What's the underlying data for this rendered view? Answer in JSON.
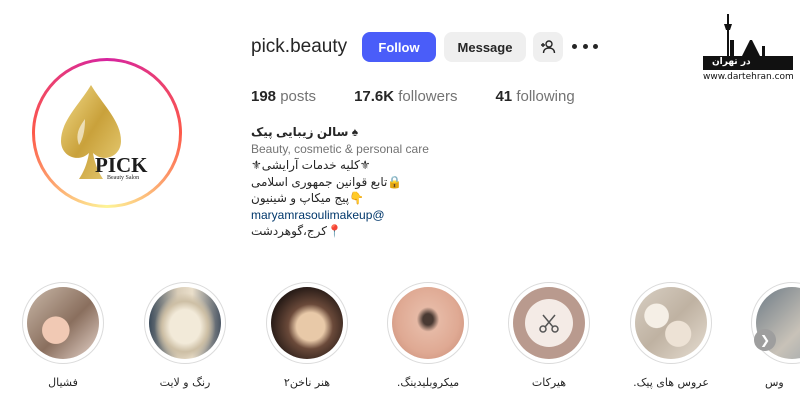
{
  "profile": {
    "username": "pick.beauty",
    "logo_text": "PICK",
    "logo_sub": "Beauty Salon"
  },
  "actions": {
    "follow_label": "Follow",
    "message_label": "Message",
    "add_user_icon": "add-user-icon",
    "more_icon": "more-icon"
  },
  "stats": {
    "posts_count": "198",
    "posts_label": "posts",
    "followers_count": "17.6K",
    "followers_label": "followers",
    "following_count": "41",
    "following_label": "following"
  },
  "bio": {
    "name": "سالن زیبایی پیک ♠",
    "category": "Beauty, cosmetic & personal care",
    "line1": "⚜کلیه خدمات آرایشی⚜",
    "line2": "تابع قوانین جمهوری اسلامی🔒",
    "line3": "پیج میکاپ و شینیون👇",
    "link": "maryamrasoulimakeup@",
    "location": "کرج،گوهردشت📍"
  },
  "watermark": {
    "site": "www.dartehran.com",
    "brand": "در تهران"
  },
  "highlights": [
    {
      "label": "فشیال"
    },
    {
      "label": "رنگ و لایت"
    },
    {
      "label": "هنر ناخن۲"
    },
    {
      "label": ".میکروبلیدینگ"
    },
    {
      "label": "هیرکات"
    },
    {
      "label": ".عروس های پیک"
    },
    {
      "label": "وس"
    }
  ],
  "colors": {
    "follow_button": "#4a5df9",
    "secondary_button": "#efefef",
    "link": "#00376b",
    "muted_text": "#737373"
  }
}
